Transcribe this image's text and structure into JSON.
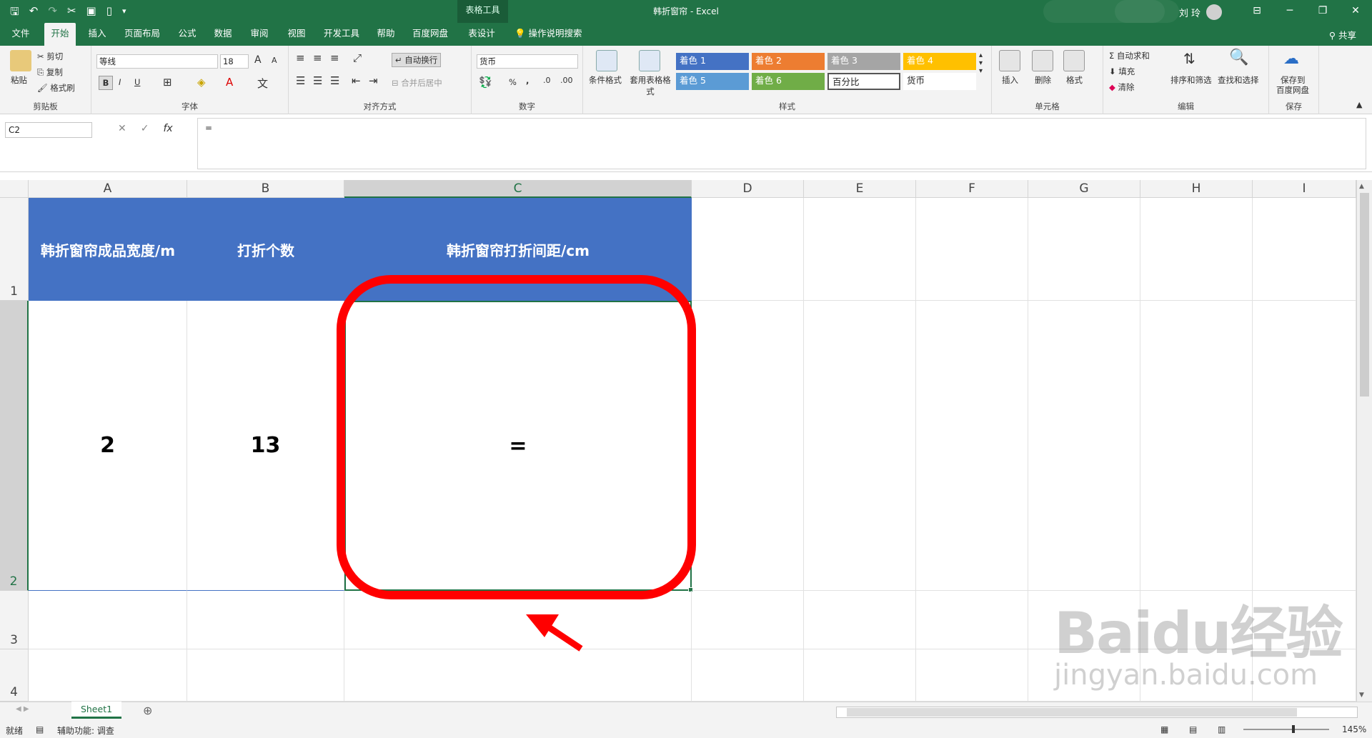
{
  "qat": {
    "save": "🖫",
    "undo": "↶",
    "redo": "↷",
    "cut": "✂",
    "screenshot": "▣",
    "new": "▯",
    "more": "▾"
  },
  "context_tab_group": "表格工具",
  "window_title": "韩折窗帘 - Excel",
  "user": "刘 玲",
  "window_buttons": [
    "⊟",
    "─",
    "❐",
    "✕"
  ],
  "tabs": [
    "文件",
    "开始",
    "插入",
    "页面布局",
    "公式",
    "数据",
    "审阅",
    "视图",
    "开发工具",
    "帮助",
    "百度网盘",
    "表设计"
  ],
  "active_tab": "开始",
  "tell_me": "操作说明搜索",
  "share": "共享",
  "clipboard": {
    "paste": "粘贴",
    "cut": "剪切",
    "copy": "复制",
    "format_painter": "格式刷",
    "label": "剪贴板"
  },
  "font": {
    "name": "等线",
    "size": "18",
    "bold": "B",
    "italic": "I",
    "underline": "U",
    "grow": "A",
    "shrink": "A",
    "label": "字体"
  },
  "alignment": {
    "wrap_text": "自动换行",
    "merge_center": "合并后居中",
    "label": "对齐方式"
  },
  "number": {
    "format": "货币",
    "percent": "%",
    "comma": ",",
    "label": "数字"
  },
  "styles": {
    "conditional_format": "条件格式",
    "format_as_table": "套用表格格式",
    "cells": [
      {
        "text": "着色 1",
        "color": "#4472c4"
      },
      {
        "text": "着色 2",
        "color": "#ed7d31"
      },
      {
        "text": "着色 3",
        "color": "#a5a5a5"
      },
      {
        "text": "着色 4",
        "color": "#ffc000"
      },
      {
        "text": "着色 5",
        "color": "#5b9bd5"
      },
      {
        "text": "着色 6",
        "color": "#70ad47"
      },
      {
        "text": "百分比",
        "color": "#ffffff"
      },
      {
        "text": "货币",
        "color": "#ffffff"
      }
    ],
    "label": "样式"
  },
  "cells_group": {
    "insert": "插入",
    "delete": "删除",
    "format": "格式",
    "label": "单元格"
  },
  "editing": {
    "autosum": "自动求和",
    "fill": "填充",
    "clear": "清除",
    "sort_filter": "排序和筛选",
    "find_select": "查找和选择",
    "label": "编辑"
  },
  "save_group": {
    "save_to": "保存到",
    "baidu": "百度网盘",
    "label": "保存"
  },
  "formula_bar": {
    "name_box": "C2",
    "fx": "fx",
    "formula": "="
  },
  "columns": [
    "A",
    "B",
    "C",
    "D",
    "E",
    "F",
    "G",
    "H",
    "I"
  ],
  "selected_column": "C",
  "rows": [
    "1",
    "2",
    "3",
    "4"
  ],
  "selected_row": "2",
  "table": {
    "headers": [
      "韩折窗帘成品宽度/m",
      "打折个数",
      "韩折窗帘打折间距/cm"
    ],
    "row2": [
      "2",
      "13",
      "="
    ]
  },
  "sheet_tab": "Sheet1",
  "add_sheet": "⊕",
  "status": {
    "ready": "就绪",
    "accessibility": "辅助功能: 调查",
    "zoom": "145%"
  },
  "annotation_color": "#ff0000",
  "watermark": {
    "brand": "Baidu经验",
    "url": "jingyan.baidu.com"
  }
}
